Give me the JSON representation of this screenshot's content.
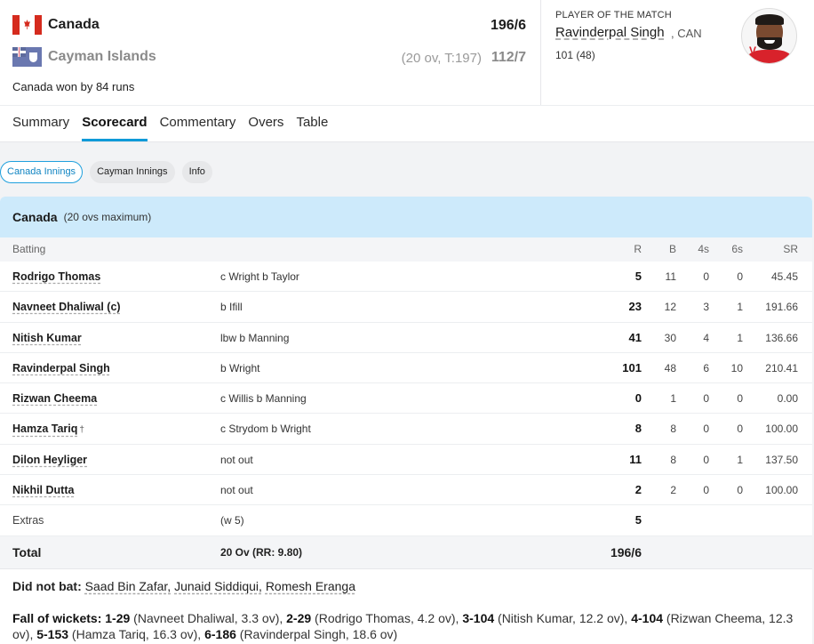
{
  "match": {
    "team1": {
      "name": "Canada",
      "score": "196/6"
    },
    "team2": {
      "name": "Cayman Islands",
      "overs_info": "(20 ov, T:197)",
      "score": "112/7"
    },
    "result": "Canada won by 84 runs"
  },
  "player_of_match": {
    "title": "PLAYER OF THE MATCH",
    "name": "Ravinderpal Singh",
    "team": ", CAN",
    "score": "101 (48)"
  },
  "tabs": [
    "Summary",
    "Scorecard",
    "Commentary",
    "Overs",
    "Table"
  ],
  "innings_pills": [
    "Canada Innings",
    "Cayman Innings",
    "Info"
  ],
  "innings": {
    "team": "Canada",
    "subtitle": "(20 ovs maximum)",
    "headers": {
      "batting": "Batting",
      "r": "R",
      "b": "B",
      "fours": "4s",
      "sixes": "6s",
      "sr": "SR"
    },
    "batters": [
      {
        "name": "Rodrigo Thomas",
        "mark": "",
        "dismissal": "c Wright b Taylor",
        "r": "5",
        "b": "11",
        "fours": "0",
        "sixes": "0",
        "sr": "45.45"
      },
      {
        "name": "Navneet Dhaliwal (c)",
        "mark": "",
        "dismissal": "b Ifill",
        "r": "23",
        "b": "12",
        "fours": "3",
        "sixes": "1",
        "sr": "191.66"
      },
      {
        "name": "Nitish Kumar",
        "mark": "",
        "dismissal": "lbw b Manning",
        "r": "41",
        "b": "30",
        "fours": "4",
        "sixes": "1",
        "sr": "136.66"
      },
      {
        "name": "Ravinderpal Singh",
        "mark": "",
        "dismissal": "b Wright",
        "r": "101",
        "b": "48",
        "fours": "6",
        "sixes": "10",
        "sr": "210.41"
      },
      {
        "name": "Rizwan Cheema",
        "mark": "",
        "dismissal": "c Willis b Manning",
        "r": "0",
        "b": "1",
        "fours": "0",
        "sixes": "0",
        "sr": "0.00"
      },
      {
        "name": "Hamza Tariq",
        "mark": "†",
        "dismissal": "c Strydom b Wright",
        "r": "8",
        "b": "8",
        "fours": "0",
        "sixes": "0",
        "sr": "100.00"
      },
      {
        "name": "Dilon Heyliger",
        "mark": "",
        "dismissal": "not out",
        "r": "11",
        "b": "8",
        "fours": "0",
        "sixes": "1",
        "sr": "137.50"
      },
      {
        "name": "Nikhil Dutta",
        "mark": "",
        "dismissal": "not out",
        "r": "2",
        "b": "2",
        "fours": "0",
        "sixes": "0",
        "sr": "100.00"
      }
    ],
    "extras": {
      "label": "Extras",
      "detail": "(w 5)",
      "value": "5"
    },
    "total": {
      "label": "Total",
      "detail": "20 Ov (RR: 9.80)",
      "value": "196/6"
    },
    "did_not_bat": {
      "label": "Did not bat:",
      "players": [
        "Saad Bin Zafar,",
        "Junaid Siddiqui,",
        "Romesh Eranga"
      ]
    },
    "fall_of_wickets": {
      "label": "Fall of wickets:",
      "items": [
        {
          "score": "1-29",
          "detail": " (Navneet Dhaliwal, 3.3 ov), "
        },
        {
          "score": "2-29",
          "detail": " (Rodrigo Thomas, 4.2 ov), "
        },
        {
          "score": "3-104",
          "detail": " (Nitish Kumar, 12.2 ov), "
        },
        {
          "score": "4-104",
          "detail": " (Rizwan Cheema, 12.3 ov), "
        },
        {
          "score": "5-153",
          "detail": " (Hamza Tariq, 16.3 ov), "
        },
        {
          "score": "6-186",
          "detail": " (Ravinderpal Singh, 18.6 ov)"
        }
      ]
    }
  },
  "colors": {
    "accent": "#0f9ad8",
    "innings_header": "#cdeafb",
    "flag_red": "#d52b1e"
  }
}
